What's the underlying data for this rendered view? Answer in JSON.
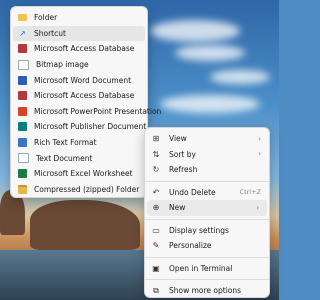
{
  "new_submenu": {
    "items": [
      {
        "label": "Folder",
        "icon": "folder-icon"
      },
      {
        "label": "Shortcut",
        "icon": "shortcut-icon"
      },
      {
        "label": "Microsoft Access Database",
        "icon": "access-icon"
      },
      {
        "label": "Bitmap image",
        "icon": "bitmap-icon"
      },
      {
        "label": "Microsoft Word Document",
        "icon": "word-icon"
      },
      {
        "label": "Microsoft Access Database",
        "icon": "access-icon"
      },
      {
        "label": "Microsoft PowerPoint Presentation",
        "icon": "powerpoint-icon"
      },
      {
        "label": "Microsoft Publisher Document",
        "icon": "publisher-icon"
      },
      {
        "label": "Rich Text Format",
        "icon": "rtf-icon"
      },
      {
        "label": "Text Document",
        "icon": "text-icon"
      },
      {
        "label": "Microsoft Excel Worksheet",
        "icon": "excel-icon"
      },
      {
        "label": "Compressed (zipped) Folder",
        "icon": "zip-folder-icon"
      }
    ],
    "selected_index": 1
  },
  "context_menu": {
    "view": "View",
    "sort_by": "Sort by",
    "refresh": "Refresh",
    "undo_delete": "Undo Delete",
    "undo_delete_shortcut": "Ctrl+Z",
    "new": "New",
    "display_settings": "Display settings",
    "personalize": "Personalize",
    "open_in_terminal": "Open in Terminal",
    "show_more_options": "Show more options"
  },
  "colors": {
    "menu_bg": "#f7f7f8",
    "highlight": "#e6e6e6"
  }
}
